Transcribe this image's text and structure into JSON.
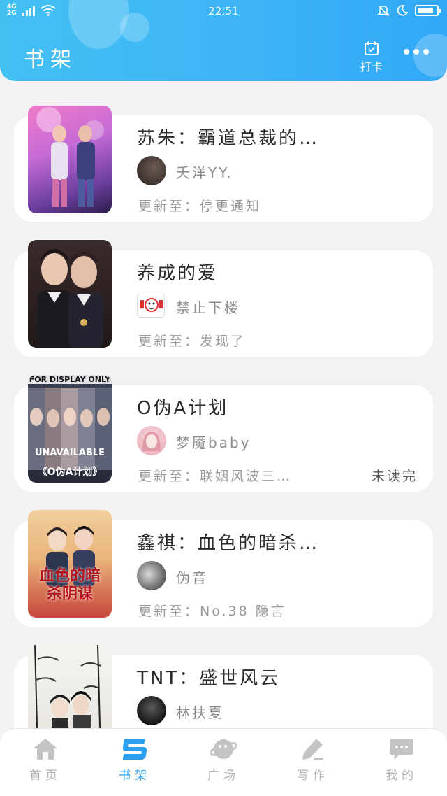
{
  "status_bar": {
    "network_top": "4G",
    "network_bottom": "2G",
    "time": "22:51"
  },
  "header": {
    "title": "书架",
    "checkin_label": "打卡"
  },
  "books": [
    {
      "title": "苏朱：霸道总裁的…",
      "author": "夭洋YY.",
      "update": "更新至：停更通知",
      "badge": ""
    },
    {
      "title": "养成的爱",
      "author": "禁止下楼",
      "update": "更新至：发现了",
      "badge": ""
    },
    {
      "title": "O伪A计划",
      "author": "梦魇baby",
      "update": "更新至：联姻风波三…",
      "badge": "未读完",
      "cover_top_text": "FOR DISPLAY ONLY",
      "cover_mid_text": "UNAVAILABLE",
      "cover_caption": "《O伪A计划》"
    },
    {
      "title": "鑫祺：血色的暗杀…",
      "author": "伪音",
      "update": "更新至：No.38 隐言",
      "badge": "",
      "cover_caption": "血色的暗杀阴谋"
    },
    {
      "title": "TNT：盛世风云",
      "author": "林扶夏",
      "update": "",
      "badge": ""
    }
  ],
  "nav": [
    {
      "label": "首页",
      "icon": "home-icon",
      "active": false
    },
    {
      "label": "书架",
      "icon": "bookshelf-icon",
      "active": true
    },
    {
      "label": "广场",
      "icon": "planet-icon",
      "active": false
    },
    {
      "label": "写作",
      "icon": "pen-icon",
      "active": false
    },
    {
      "label": "我的",
      "icon": "chat-bubble-icon",
      "active": false
    }
  ],
  "colors": {
    "header_gradient_start": "#42c0f2",
    "header_gradient_end": "#31a8f7",
    "nav_active": "#2b9ff0",
    "nav_inactive": "#b5b5b5",
    "battery_level": 0.85
  }
}
